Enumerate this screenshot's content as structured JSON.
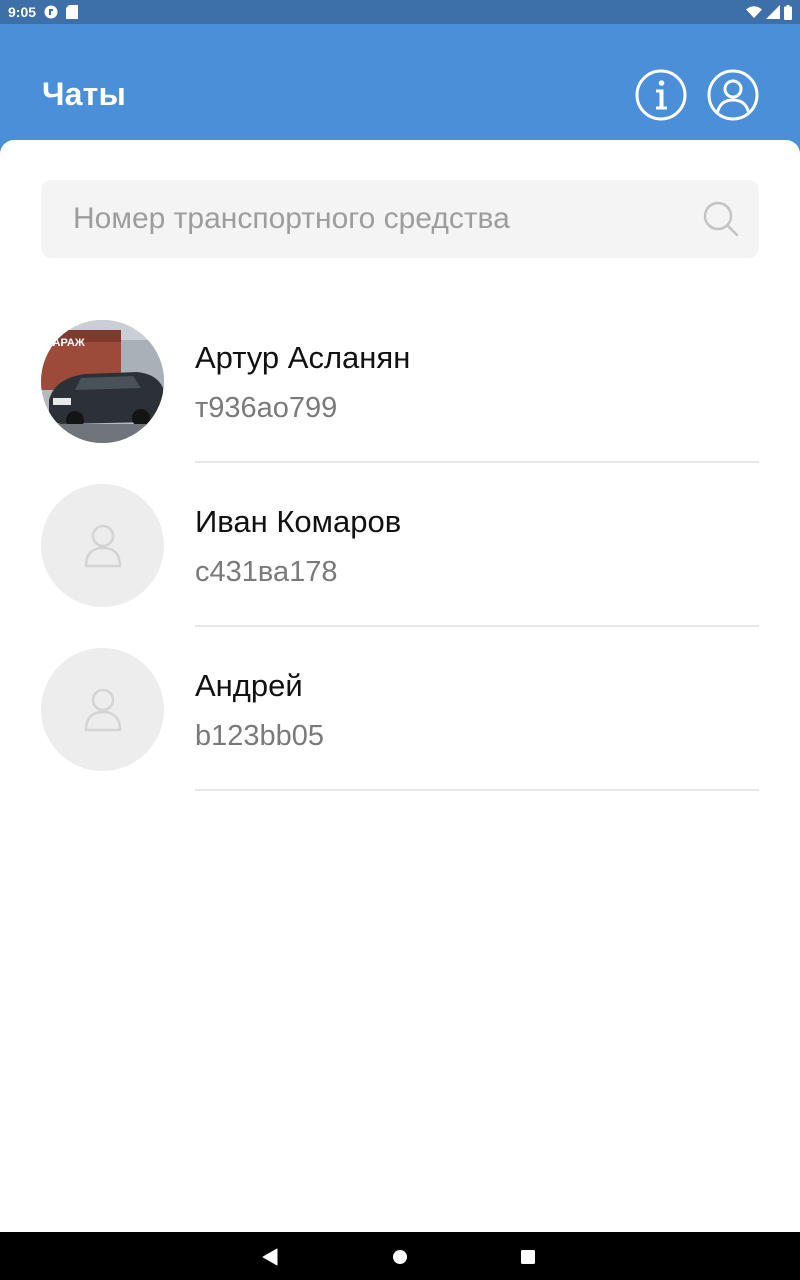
{
  "status_bar": {
    "time": "9:05",
    "icons": [
      "notification-app-icon",
      "sd-card-icon",
      "wifi-icon",
      "signal-icon",
      "battery-icon"
    ]
  },
  "app_bar": {
    "title": "Чаты",
    "actions": [
      {
        "name": "info-button",
        "icon": "info-icon"
      },
      {
        "name": "profile-button",
        "icon": "user-circle-icon"
      }
    ]
  },
  "search": {
    "placeholder": "Номер транспортного средства",
    "value": ""
  },
  "chats": [
    {
      "name": "Артур Асланян",
      "plate": "т936ао799",
      "avatar": "car-photo"
    },
    {
      "name": "Иван Комаров",
      "plate": "с431ва178",
      "avatar": "placeholder"
    },
    {
      "name": "Андрей",
      "plate": "b123bb05",
      "avatar": "placeholder"
    }
  ],
  "nav_bar": {
    "buttons": [
      "back",
      "home",
      "recents"
    ]
  },
  "colors": {
    "app_bar": "#4a8fd8",
    "status_bar": "#3d6fa8",
    "search_bg": "#f4f4f4",
    "divider": "#e6e6e6"
  }
}
